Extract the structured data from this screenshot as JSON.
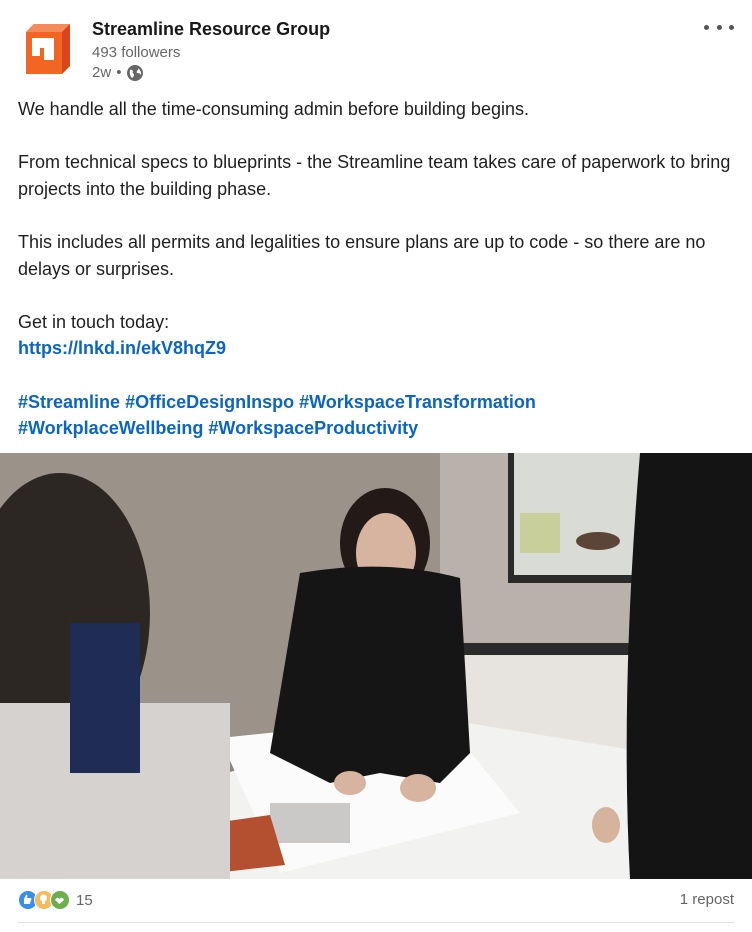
{
  "post": {
    "company_name": "Streamline Resource Group",
    "followers": "493 followers",
    "time": "2w",
    "separator": "•",
    "visibility_icon": "globe-icon",
    "more_icon": "more-horizontal-icon",
    "paragraphs": [
      "We handle all the time-consuming admin before building begins.",
      "From technical specs to blueprints - the Streamline team takes care of paperwork to bring projects into the building phase.",
      "This includes all permits and legalities to ensure plans are up to code - so there are no delays or surprises."
    ],
    "cta": "Get in touch today:",
    "link": "https://lnkd.in/ekV8hqZ9",
    "hashtags": [
      "#Streamline",
      "#OfficeDesignInspo",
      "#WorkspaceTransformation",
      "#WorkplaceWellbeing",
      "#WorkspaceProductivity"
    ]
  },
  "engagement": {
    "reaction_icons": [
      "like-icon",
      "insightful-icon",
      "support-icon"
    ],
    "reaction_count": "15",
    "reposts": "1 repost"
  },
  "colors": {
    "link": "#0a66c2",
    "brand_orange": "#f04e23",
    "muted_text": "#666666"
  }
}
